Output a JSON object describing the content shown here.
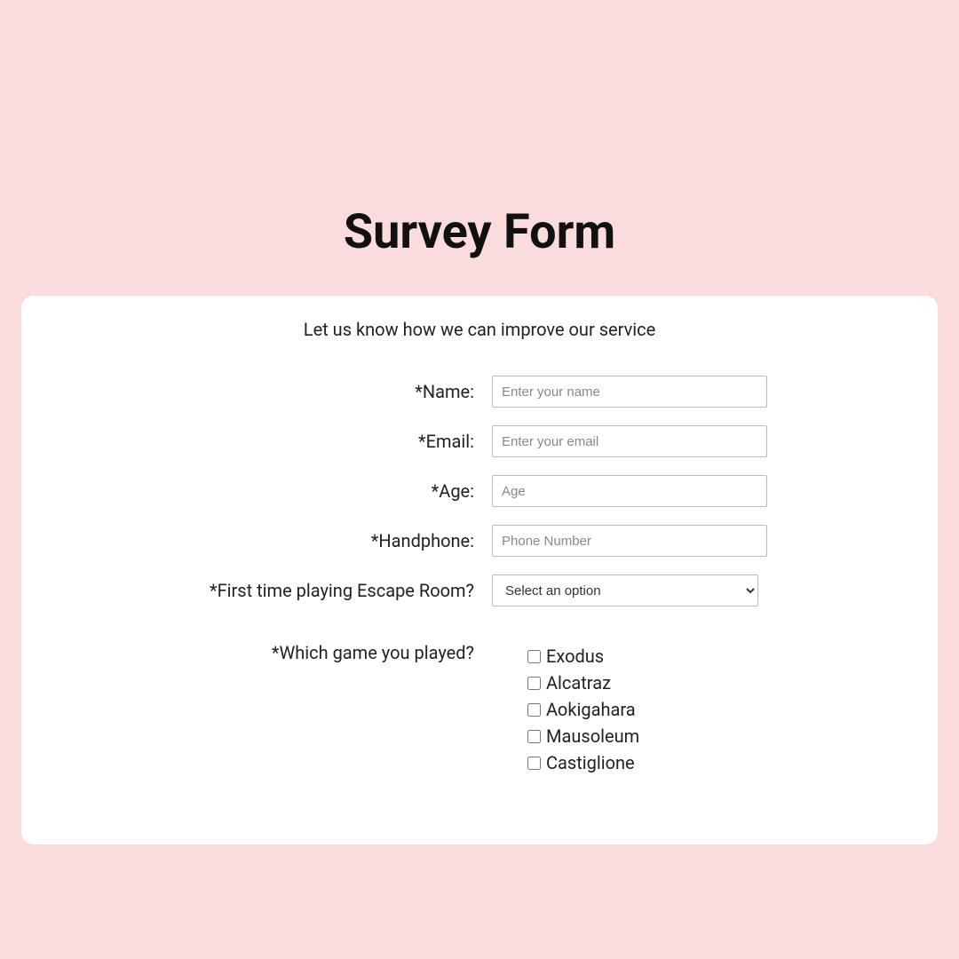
{
  "title": "Survey Form",
  "subtitle": "Let us know how we can improve our service",
  "fields": {
    "name": {
      "label": "*Name:",
      "placeholder": "Enter your name"
    },
    "email": {
      "label": "*Email:",
      "placeholder": "Enter your email"
    },
    "age": {
      "label": "*Age:",
      "placeholder": "Age"
    },
    "handphone": {
      "label": "*Handphone:",
      "placeholder": "Phone Number"
    },
    "firstTime": {
      "label": "*First time playing Escape Room?",
      "selected": "Select an option"
    },
    "games": {
      "label": "*Which game you played?"
    }
  },
  "game_options": [
    "Exodus",
    "Alcatraz",
    "Aokigahara",
    "Mausoleum",
    "Castiglione"
  ]
}
